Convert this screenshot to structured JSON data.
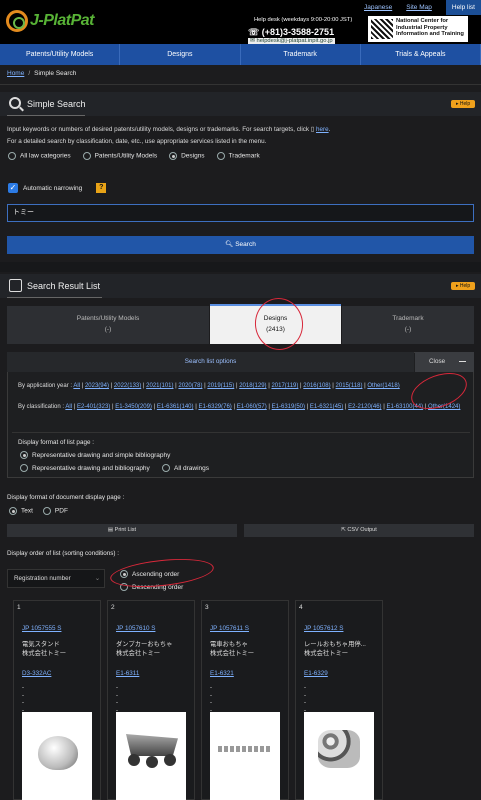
{
  "header": {
    "logo_text": "J-PlatPat",
    "links": [
      "Japanese",
      "Site Map"
    ],
    "help_list": "Help list",
    "helpdesk": "Help desk (weekdays 9:00-20:00 JST)",
    "phone": "(+81)3-3588-2751",
    "email": "helpdesk@j-platpat.inpit.go.jp",
    "org_line1": "National Center for",
    "org_line2": "Industrial Property",
    "org_line3": "Information and Training",
    "org_abbr": "INPIT"
  },
  "nav": [
    "Patents/Utility Models",
    "Designs",
    "Trademark",
    "Trials & Appeals"
  ],
  "breadcrumb": {
    "home": "Home",
    "current": "Simple Search"
  },
  "simple_search": {
    "title": "Simple Search",
    "help": "Help",
    "intro1": "Input keywords or numbers of desired patents/utility models, designs or trademarks. For search targets, click",
    "here": "here",
    "intro2": "For a detailed search by classification, date, etc., use appropriate services listed in the menu.",
    "categories": [
      "All law categories",
      "Patents/Utility Models",
      "Designs",
      "Trademark"
    ],
    "selected_category": "Designs",
    "auto_narrowing": "Automatic narrowing",
    "keyword": "トミー",
    "search_button": "Search"
  },
  "result": {
    "title": "Search Result List",
    "help": "Help",
    "tabs": [
      {
        "label": "Patents/Utility Models",
        "count": "(-)"
      },
      {
        "label": "Designs",
        "count": "(2413)"
      },
      {
        "label": "Trademark",
        "count": "(-)"
      }
    ],
    "options_title": "Search list options",
    "close": "Close",
    "by_year_label": "By application year :",
    "years": [
      "All",
      "2023(94)",
      "2022(133)",
      "2021(101)",
      "2020(78)",
      "2019(115)",
      "2018(129)",
      "2017(119)",
      "2016(108)",
      "2015(118)",
      "Other(1418)"
    ],
    "by_class_label": "By classification :",
    "classes": [
      "All",
      "E2-401(323)",
      "E1-3450(209)",
      "E1-6361(140)",
      "E1-6329(76)",
      "E1-060(57)",
      "E1-6319(50)",
      "E1-6321(45)",
      "E2-2120(46)",
      "E1-63100(44)",
      "Other(1424)"
    ],
    "list_format_label": "Display format of list page :",
    "list_formats": [
      "Representative drawing and simple bibliography",
      "Representative drawing and bibliography",
      "All drawings"
    ],
    "doc_format_label": "Display format of document display page :",
    "doc_formats": [
      "Text",
      "PDF"
    ],
    "print_list": "Print List",
    "csv_output": "CSV Output",
    "order_label": "Display order of list (sorting conditions) :",
    "sort_field": "Registration number",
    "ascending": "Ascending order",
    "descending": "Descending order"
  },
  "cards": [
    {
      "num": "1",
      "id": "JP 1057555 S",
      "name1": "電気スタンド",
      "name2": "株式会社トミー",
      "cls": "D3-332AC",
      "dashes": "-\n-\n-\n-"
    },
    {
      "num": "2",
      "id": "JP 1057610 S",
      "name1": "ダンプカーおもちゃ",
      "name2": "株式会社トミー",
      "cls": "E1-6311",
      "dashes": "-\n-\n-\n-"
    },
    {
      "num": "3",
      "id": "JP 1057611 S",
      "name1": "電車おもちゃ",
      "name2": "株式会社トミー",
      "cls": "E1-6321",
      "dashes": "-\n-\n-\n-"
    },
    {
      "num": "4",
      "id": "JP 1057612 S",
      "name1": "レールおもちゃ用停...",
      "name2": "株式会社トミー",
      "cls": "E1-6329",
      "dashes": "-\n-\n-\n-"
    }
  ],
  "colors": {
    "nav": "#1e50a2",
    "accent": "#2156a8",
    "help": "#f0a11c",
    "annotation": "#d7283a"
  }
}
